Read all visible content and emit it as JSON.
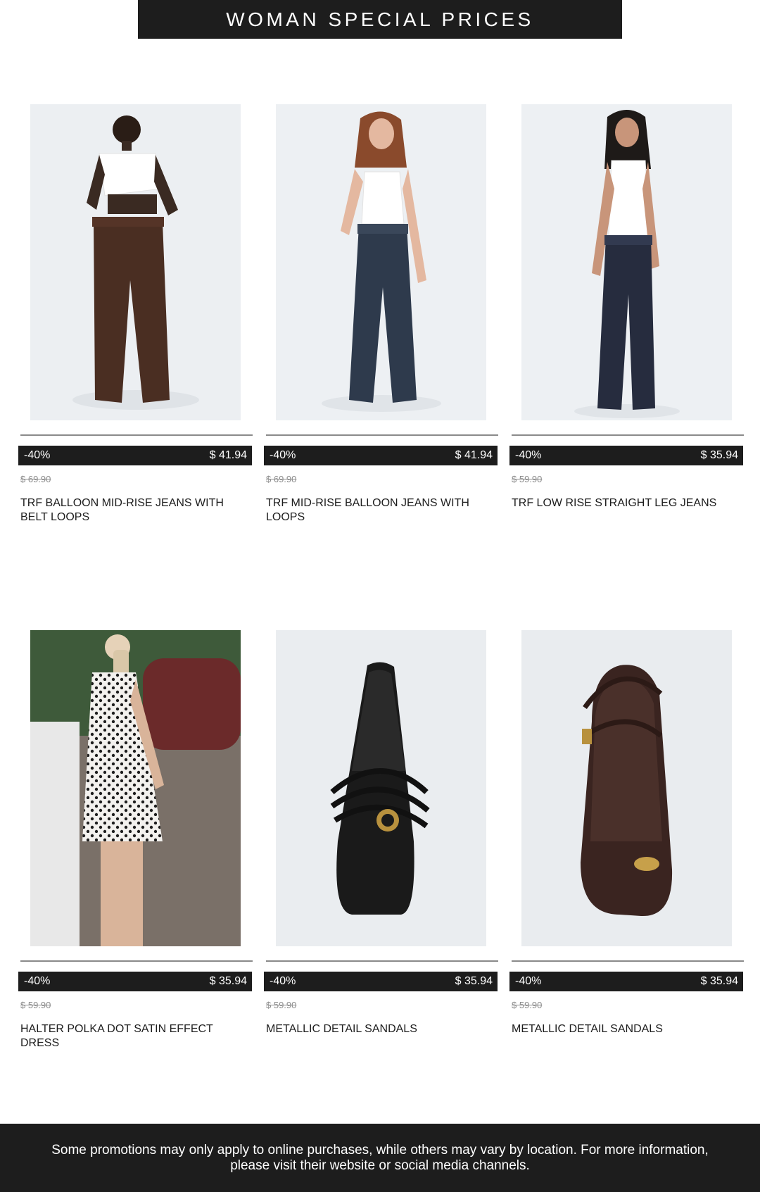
{
  "header": {
    "title": "WOMAN SPECIAL PRICES"
  },
  "products": [
    {
      "discount": "-40%",
      "price": "$ 41.94",
      "old_price": "$ 69.90",
      "name": "TRF BALLOON MID-RISE JEANS WITH BELT LOOPS"
    },
    {
      "discount": "-40%",
      "price": "$ 41.94",
      "old_price": "$ 69.90",
      "name": "TRF MID-RISE BALLOON JEANS WITH LOOPS"
    },
    {
      "discount": "-40%",
      "price": "$ 35.94",
      "old_price": "$ 59.90",
      "name": "TRF LOW RISE STRAIGHT LEG JEANS"
    },
    {
      "discount": "-40%",
      "price": "$ 35.94",
      "old_price": "$ 59.90",
      "name": "HALTER POLKA DOT SATIN EFFECT DRESS"
    },
    {
      "discount": "-40%",
      "price": "$ 35.94",
      "old_price": "$ 59.90",
      "name": "METALLIC DETAIL SANDALS"
    },
    {
      "discount": "-40%",
      "price": "$ 35.94",
      "old_price": "$ 59.90",
      "name": "METALLIC DETAIL SANDALS"
    }
  ],
  "footer": {
    "text": "Some promotions may only apply to online purchases, while others may vary by location. For more information, please visit their website or social media channels."
  },
  "colors": {
    "dark": "#1d1d1d",
    "old_price": "#8c8c8c",
    "divider": "#8a8a8a"
  }
}
